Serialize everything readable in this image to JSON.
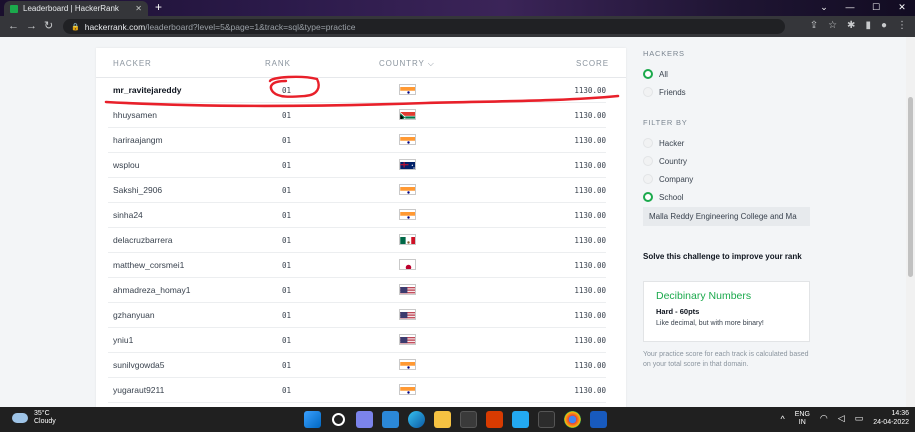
{
  "browser": {
    "tab_title": "Leaderboard | HackerRank",
    "tab_close": "✕",
    "new_tab": "+",
    "url_host": "hackerrank.com",
    "url_path": "/leaderboard?level=5&page=1&track=sql&type=practice",
    "icons": [
      "back-icon",
      "forward-icon",
      "reload-icon",
      "share-icon",
      "star-icon",
      "extensions-icon",
      "sidepanel-icon",
      "profile-icon",
      "menu-icon"
    ]
  },
  "leaderboard": {
    "columns": {
      "hacker": "HACKER",
      "rank": "RANK",
      "country": "COUNTRY",
      "score": "SCORE"
    },
    "rows": [
      {
        "hacker": "mr_ravitejareddy",
        "rank": "01",
        "country": "India",
        "score": "1130.00"
      },
      {
        "hacker": "hhuysamen",
        "rank": "01",
        "country": "South Africa",
        "score": "1130.00"
      },
      {
        "hacker": "hariraajangm",
        "rank": "01",
        "country": "India",
        "score": "1130.00"
      },
      {
        "hacker": "wsplou",
        "rank": "01",
        "country": "Australia",
        "score": "1130.00"
      },
      {
        "hacker": "Sakshi_2906",
        "rank": "01",
        "country": "India",
        "score": "1130.00"
      },
      {
        "hacker": "sinha24",
        "rank": "01",
        "country": "India",
        "score": "1130.00"
      },
      {
        "hacker": "delacruzbarrera",
        "rank": "01",
        "country": "Mexico",
        "score": "1130.00"
      },
      {
        "hacker": "matthew_corsmei1",
        "rank": "01",
        "country": "Japan",
        "score": "1130.00"
      },
      {
        "hacker": "ahmadreza_homay1",
        "rank": "01",
        "country": "United States",
        "score": "1130.00"
      },
      {
        "hacker": "gzhanyuan",
        "rank": "01",
        "country": "United States",
        "score": "1130.00"
      },
      {
        "hacker": "yniu1",
        "rank": "01",
        "country": "United States",
        "score": "1130.00"
      },
      {
        "hacker": "sunilvgowda5",
        "rank": "01",
        "country": "India",
        "score": "1130.00"
      },
      {
        "hacker": "yugaraut9211",
        "rank": "01",
        "country": "India",
        "score": "1130.00"
      }
    ]
  },
  "sidebar": {
    "hackers_heading": "HACKERS",
    "hackers_options": [
      {
        "label": "All",
        "selected": true
      },
      {
        "label": "Friends",
        "selected": false
      }
    ],
    "filter_heading": "FILTER BY",
    "filter_options": [
      {
        "label": "Hacker",
        "selected": false
      },
      {
        "label": "Country",
        "selected": false
      },
      {
        "label": "Company",
        "selected": false
      },
      {
        "label": "School",
        "selected": true
      }
    ],
    "school_value": "Malla Reddy Engineering College and Ma",
    "solve_heading": "Solve this challenge to improve your rank",
    "challenge": {
      "title": "Decibinary Numbers",
      "difficulty": "Hard - 60pts",
      "subtitle": "Like decimal, but with more binary!"
    },
    "note": "Your practice score for each track is calculated based on your total score in that domain."
  },
  "taskbar": {
    "temperature": "35°C",
    "condition": "Cloudy",
    "lang_top": "ENG",
    "lang_bottom": "IN",
    "time": "14:36",
    "date": "24-04-2022"
  },
  "colors": {
    "accent_green": "#1ba94c",
    "annotation_red": "#e8202a"
  }
}
